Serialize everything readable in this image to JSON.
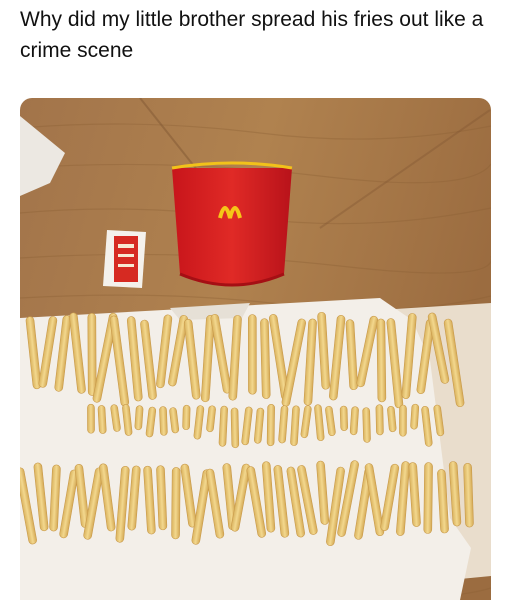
{
  "post": {
    "caption": "Why did my little brother spread his fries out like a crime scene"
  },
  "photo": {
    "logo_text": "M",
    "colors": {
      "table_wood": "#a87a4c",
      "carton_red": "#d91e22",
      "logo_yellow": "#f5c518",
      "paper": "#f2eee8",
      "fries": "#eccb78"
    }
  }
}
